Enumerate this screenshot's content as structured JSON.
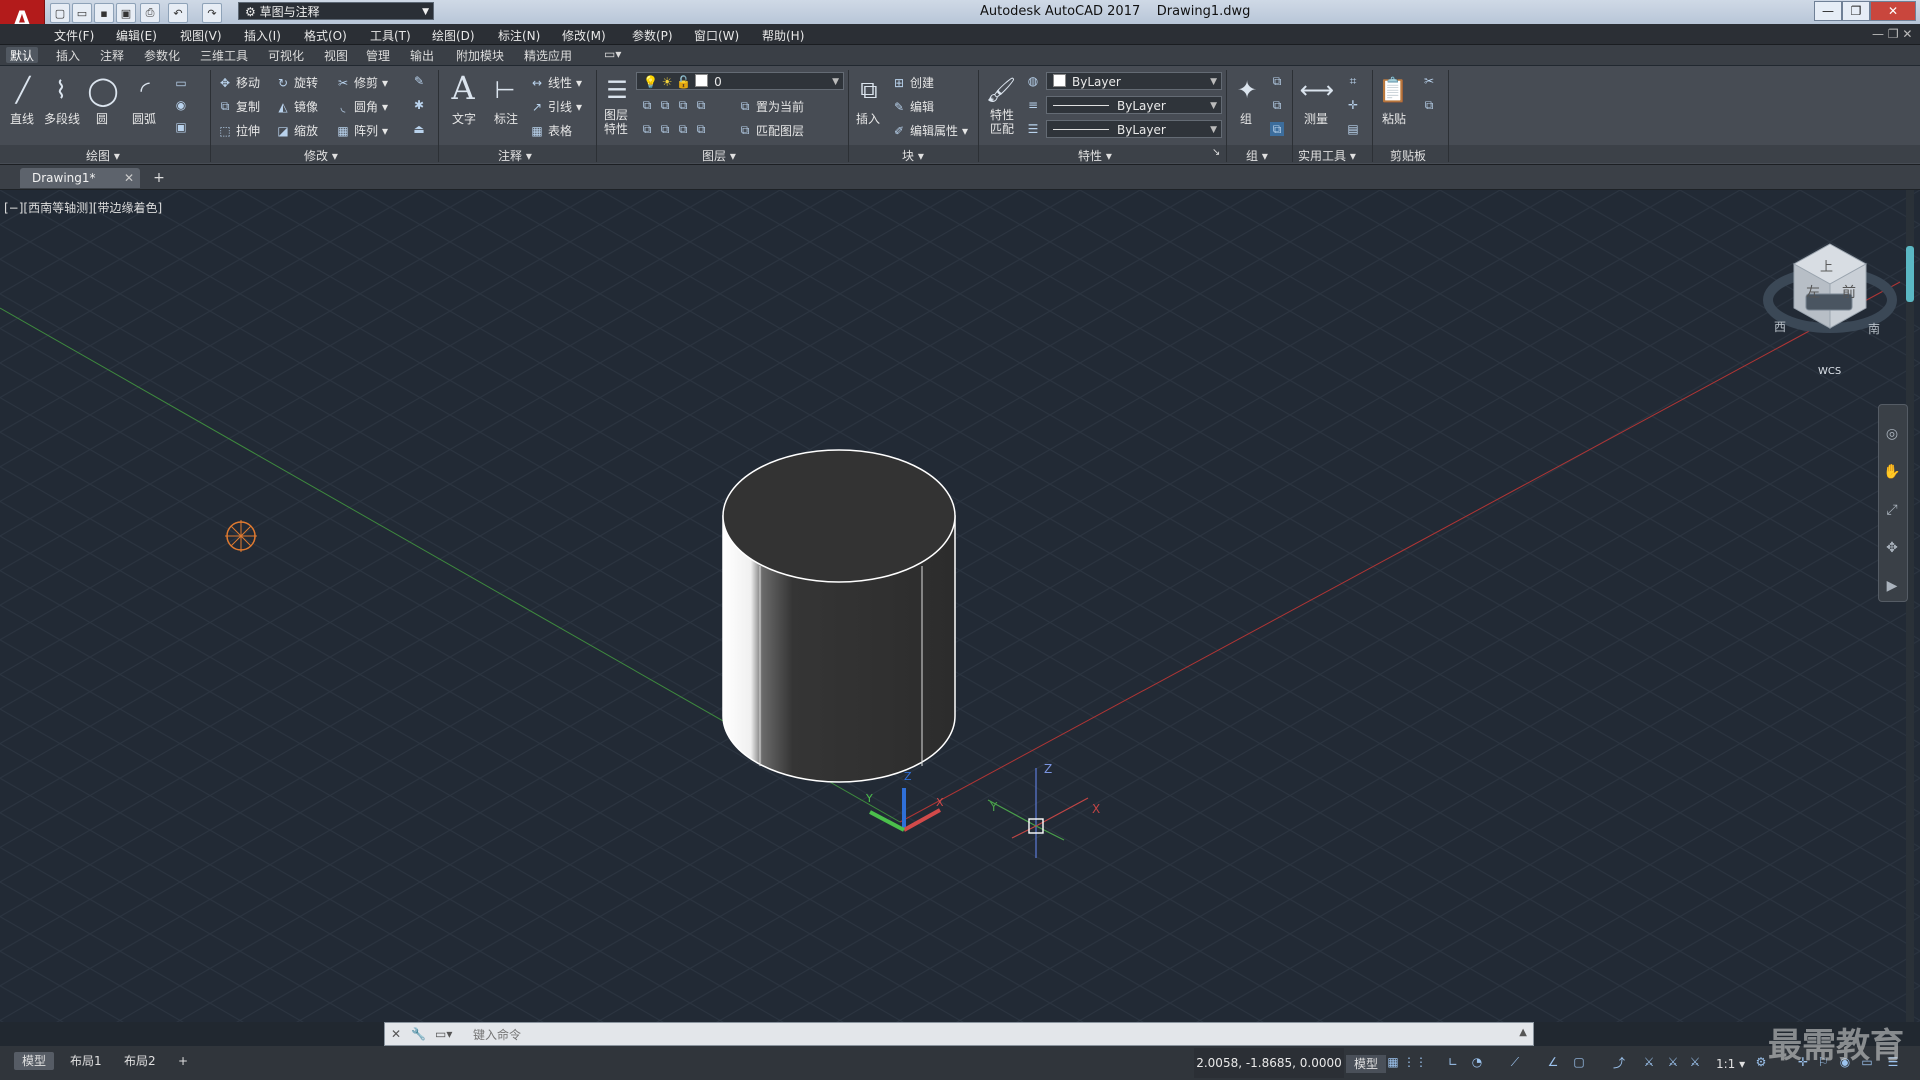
{
  "app": {
    "title": "Autodesk AutoCAD 2017",
    "document": "Drawing1.dwg",
    "logo_letter": "A",
    "workspace": "草图与注释"
  },
  "window_buttons": [
    "—",
    "❐",
    "✕"
  ],
  "menu": [
    "文件(F)",
    "编辑(E)",
    "视图(V)",
    "插入(I)",
    "格式(O)",
    "工具(T)",
    "绘图(D)",
    "标注(N)",
    "修改(M)",
    "参数(P)",
    "窗口(W)",
    "帮助(H)"
  ],
  "ribbon_tabs": [
    "默认",
    "插入",
    "注释",
    "参数化",
    "三维工具",
    "可视化",
    "视图",
    "管理",
    "输出",
    "附加模块",
    "精选应用"
  ],
  "ribbon_tab_active": "默认",
  "panels": {
    "draw": {
      "title": "绘图",
      "big": [
        "直线",
        "多段线",
        "圆",
        "圆弧"
      ]
    },
    "modify": {
      "title": "修改",
      "items": [
        "移动",
        "旋转",
        "修剪",
        "复制",
        "镜像",
        "圆角",
        "拉伸",
        "缩放",
        "阵列"
      ]
    },
    "annotation": {
      "title": "注释",
      "big": [
        "文字",
        "标注"
      ],
      "items": [
        "线性",
        "引线",
        "表格"
      ]
    },
    "layers": {
      "title": "图层",
      "big": "图层特性",
      "layer_value": "0",
      "items": [
        "置为当前",
        "匹配图层"
      ]
    },
    "block": {
      "title": "块",
      "big": "插入",
      "items": [
        "创建",
        "编辑",
        "编辑属性"
      ]
    },
    "properties": {
      "title": "特性",
      "big": "特性匹配",
      "color": "ByLayer",
      "linetype": "ByLayer",
      "lineweight": "ByLayer"
    },
    "groups": {
      "title": "组",
      "big": "组"
    },
    "utilities": {
      "title": "实用工具",
      "big": "测量"
    },
    "clipboard": {
      "title": "剪贴板",
      "big": "粘贴"
    }
  },
  "file_tab": "Drawing1*",
  "viewport_label": "[−][西南等轴测][带边缘着色]",
  "viewcube": {
    "top": "上",
    "left": "左",
    "front": "前",
    "west": "西",
    "south": "南",
    "wcs": "WCS"
  },
  "axis_labels": {
    "x": "X",
    "y": "Y",
    "z": "Z"
  },
  "command_placeholder": "键入命令",
  "layout_tabs": [
    "模型",
    "布局1",
    "布局2"
  ],
  "layout_active": "模型",
  "coordinates": "2.0058, -1.8685, 0.0000",
  "status_model": "模型",
  "scale": "1:1",
  "watermark": "最需教育",
  "colors": {
    "background": "#222a35",
    "x_axis": "#b03535",
    "y_axis": "#3e8a3e",
    "cylinder_edge": "#ffffff",
    "cylinder_body": "#333333",
    "cursor_marker": "#e07a30"
  }
}
